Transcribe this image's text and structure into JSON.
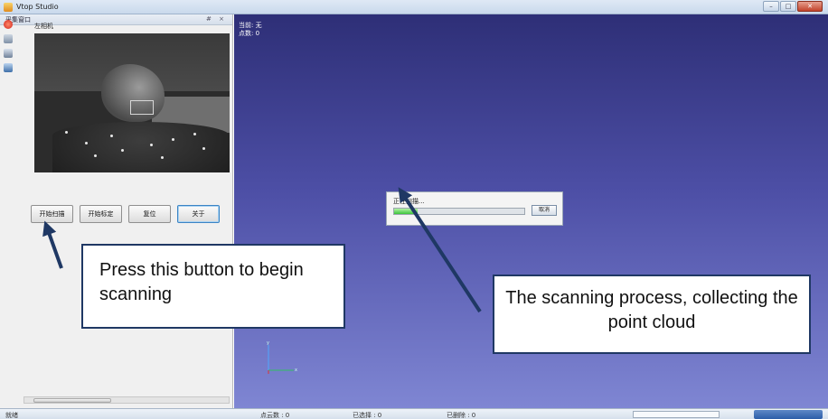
{
  "window": {
    "title": "Vtop Studio"
  },
  "left_panel": {
    "panel_title": "采集窗口",
    "panel_controls": "# ×",
    "camera_label": "左相机",
    "buttons": [
      {
        "label": "开始扫描"
      },
      {
        "label": "开始标定"
      },
      {
        "label": "复位"
      },
      {
        "label": "关于"
      }
    ],
    "tool_icons": [
      "record-icon",
      "camera-icon",
      "monitor-icon",
      "network-icon"
    ]
  },
  "viewport": {
    "info_line1": "当前: 无",
    "info_line2": "点数: 0",
    "progress_dialog": {
      "text": "正在扫描...",
      "progress": 0.18,
      "cancel_label": "取消"
    },
    "axes": {
      "x_label": "x",
      "y_label": "y"
    }
  },
  "statusbar": {
    "left_text": "就绪",
    "points": "点云数 : 0",
    "selected": "已选择 : 0",
    "deleted": "已删除 : 0"
  },
  "callouts": {
    "scan_button": "Press this button to begin scanning",
    "scan_process": "The scanning process, collecting the point cloud"
  },
  "colors": {
    "viewport_top": "#2e2f77",
    "viewport_bottom": "#7f86d3",
    "callout_border": "#1f3864",
    "progress_fill": "#3cc43a"
  }
}
